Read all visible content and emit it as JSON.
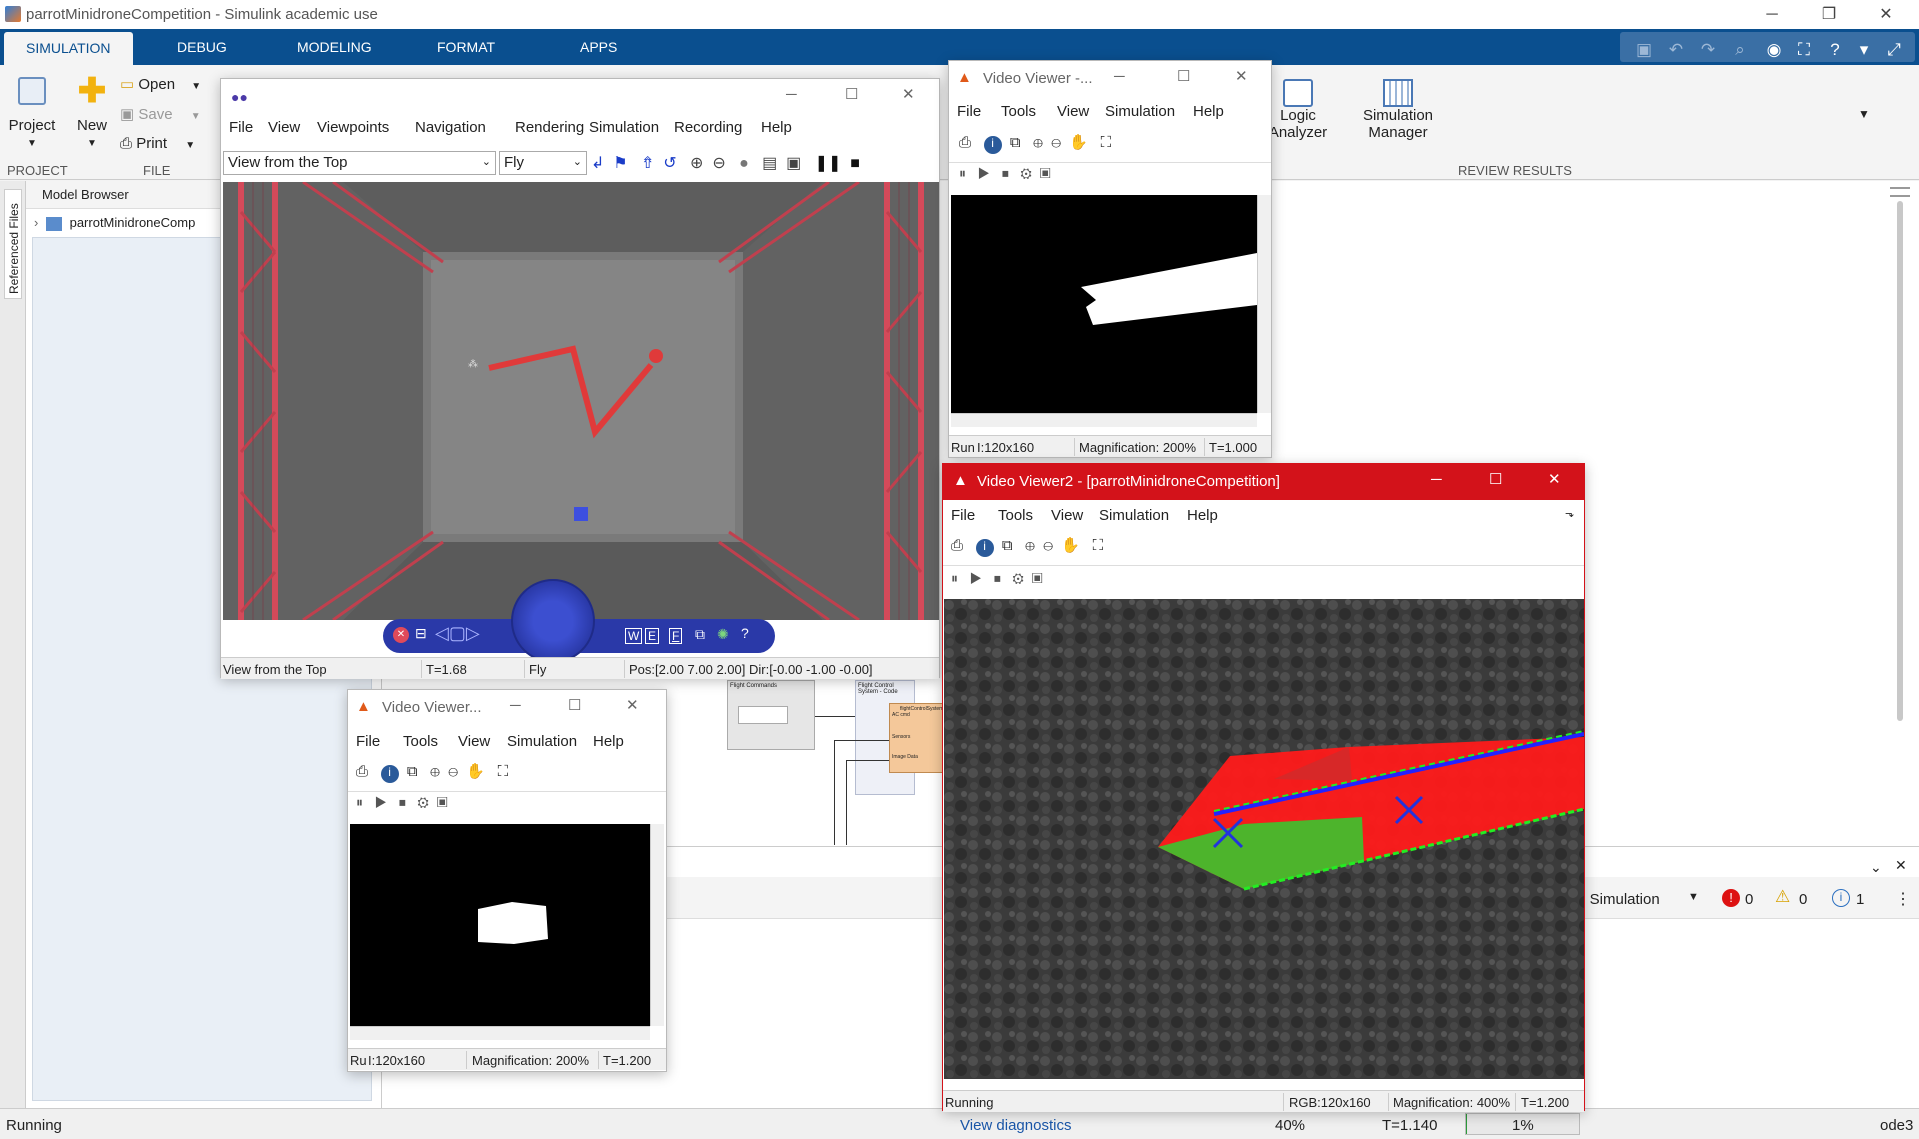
{
  "app": {
    "title": "parrotMinidroneCompetition - Simulink academic use",
    "min": "─",
    "max": "❐",
    "close": "✕"
  },
  "tabs": [
    "SIMULATION",
    "DEBUG",
    "MODELING",
    "FORMAT",
    "APPS"
  ],
  "ribbon": {
    "project": "Project",
    "new": "New",
    "open": "Open",
    "save": "Save",
    "print": "Print",
    "sec_project": "PROJECT",
    "sec_file": "FILE",
    "logic": "Logic",
    "analyzer": "Analyzer",
    "sim_mgr_1": "Simulation",
    "sim_mgr_2": "Manager",
    "sec_review": "REVIEW RESULTS"
  },
  "side": {
    "referenced_files": "Referenced Files",
    "model_browser": "Model Browser",
    "tree_item": "parrotMinidroneComp"
  },
  "vr": {
    "menu": [
      "File",
      "View",
      "Viewpoints",
      "Navigation",
      "Rendering",
      "Simulation",
      "Recording",
      "Help"
    ],
    "viewpoint": "View from the Top",
    "nav_mode": "Fly",
    "status": {
      "view": "View from the Top",
      "time": "T=1.68",
      "mode": "Fly",
      "pos": "Pos:[2.00 7.00 2.00] Dir:[-0.00 -1.00 -0.00]"
    },
    "nav_letters": [
      "W",
      "E",
      "F"
    ]
  },
  "vv1": {
    "title": "Video Viewer -...",
    "menu": [
      "File",
      "Tools",
      "View",
      "Simulation",
      "Help"
    ],
    "status": {
      "run": "Run",
      "size": "I:120x160",
      "mag": "Magnification: 200%",
      "time": "T=1.000"
    }
  },
  "vv2": {
    "title": "Video Viewer2 - [parrotMinidroneCompetition]",
    "menu": [
      "File",
      "Tools",
      "View",
      "Simulation",
      "Help"
    ],
    "status": {
      "run": "Running",
      "size": "RGB:120x160",
      "mag": "Magnification: 400%",
      "time": "T=1.200"
    }
  },
  "vv3": {
    "title": "Video Viewer...",
    "menu": [
      "File",
      "Tools",
      "View",
      "Simulation",
      "Help"
    ],
    "status": {
      "run": "Ru",
      "size": "I:120x160",
      "mag": "Magnification: 200%",
      "time": "T=1.200"
    }
  },
  "canvas": {
    "block1": "Flight Commands",
    "block2": "Flight Control System - Code",
    "port1": "flightControlSystem",
    "port2": "AC cmd",
    "port3": "Sensors",
    "port4": "Image Data",
    "port5": "Actu"
  },
  "diag": {
    "filter": "l: Simulation",
    "errors": "0",
    "warnings": "0",
    "info": "1"
  },
  "statusbar": {
    "left": "Running",
    "diag": "View diagnostics",
    "zoom": "40%",
    "time": "T=1.140",
    "progress": "1%",
    "solver": "ode3"
  },
  "colors": {
    "accent": "#0a4f8f",
    "red_title": "#d3121a",
    "track": "#e03a3a",
    "truss": "#d44a5a"
  }
}
